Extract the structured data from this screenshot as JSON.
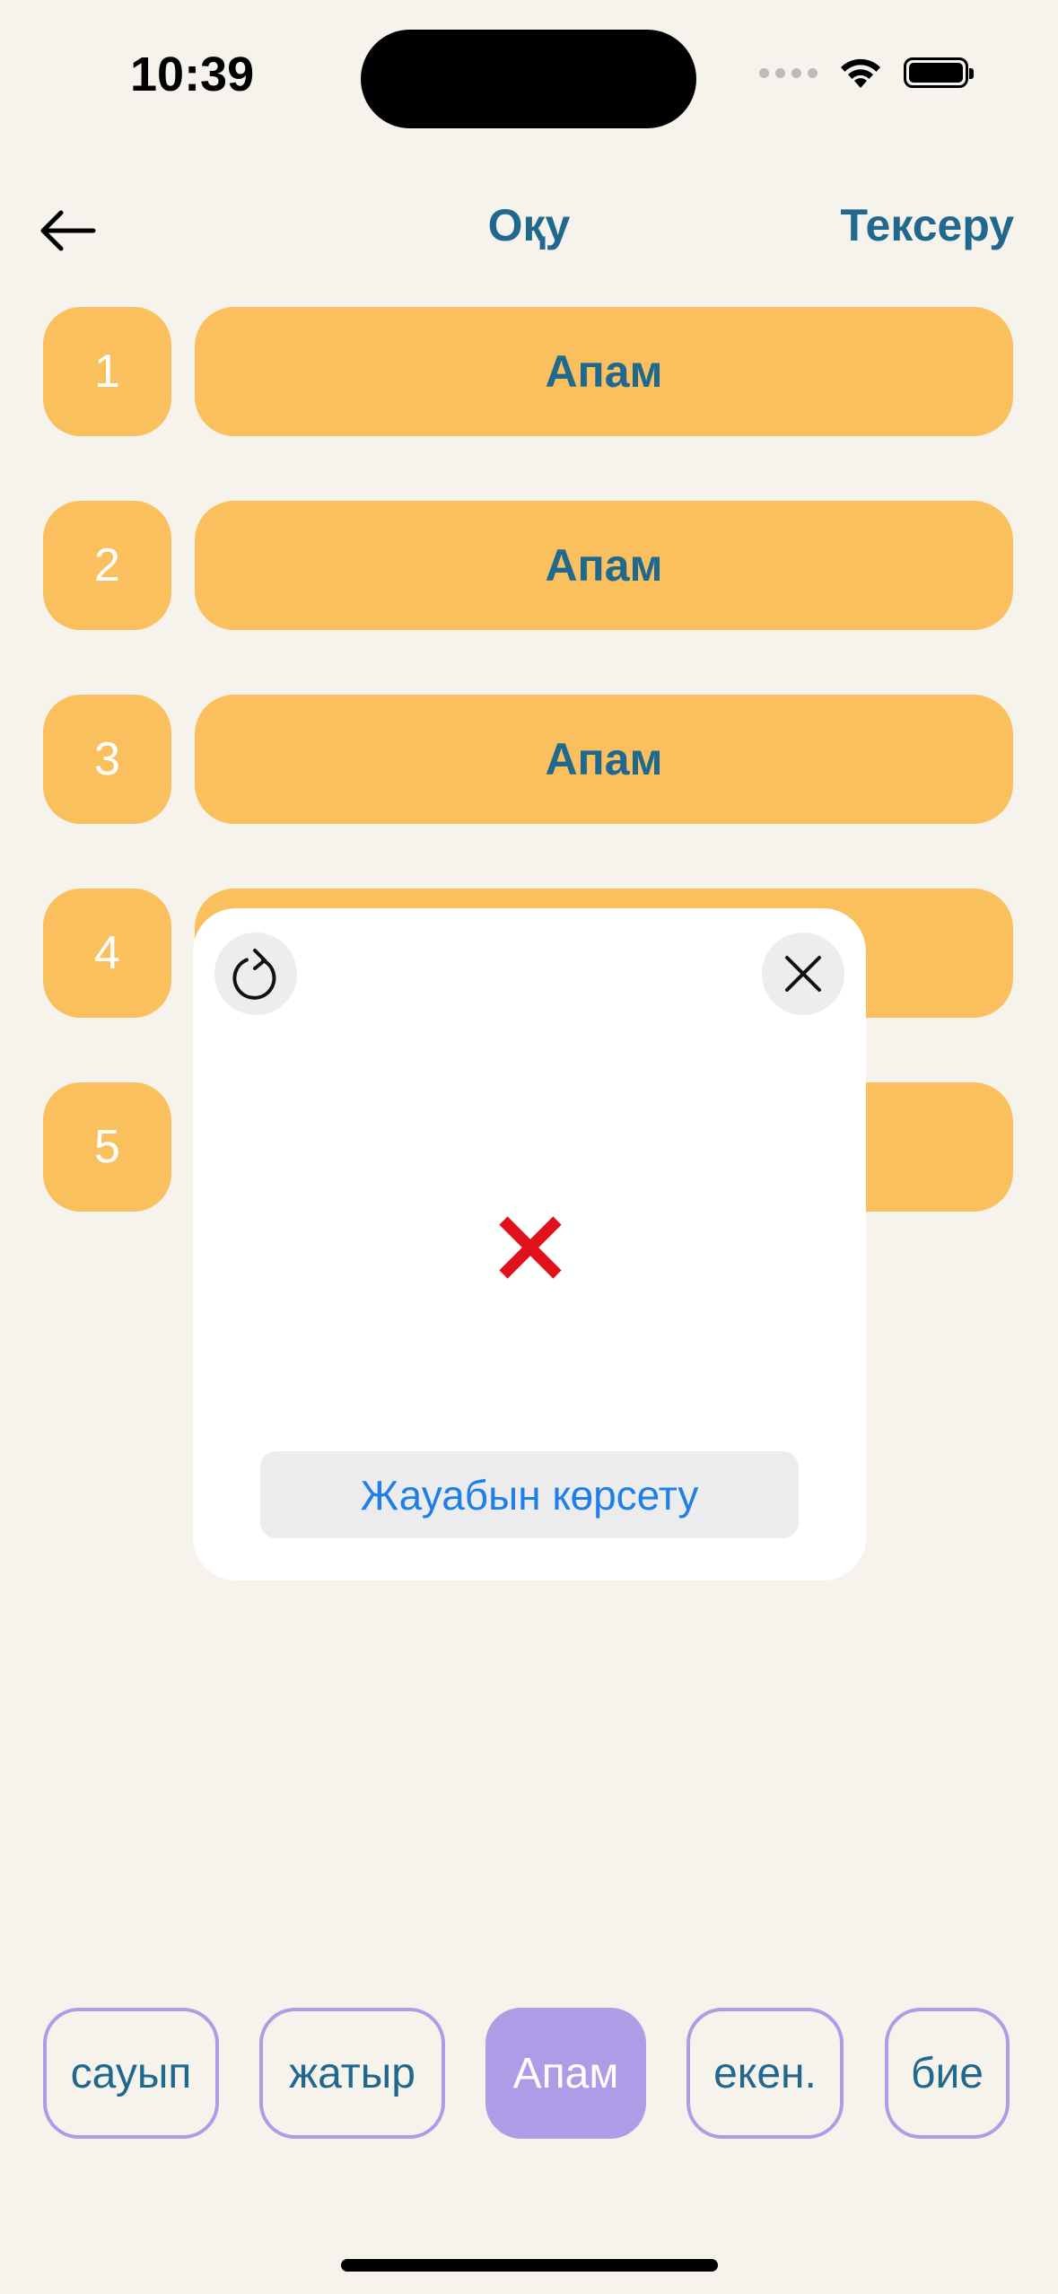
{
  "status_bar": {
    "time": "10:39"
  },
  "nav": {
    "title": "Оқу",
    "check_label": "Тексеру"
  },
  "rows": [
    {
      "number": "1",
      "answer": "Апам"
    },
    {
      "number": "2",
      "answer": "Апам"
    },
    {
      "number": "3",
      "answer": "Апам"
    },
    {
      "number": "4",
      "answer": ""
    },
    {
      "number": "5",
      "answer": ""
    }
  ],
  "popup": {
    "result": "incorrect",
    "show_answer_label": "Жауабын көрсету"
  },
  "word_bank": [
    {
      "label": "сауып",
      "selected": false
    },
    {
      "label": "жатыр",
      "selected": false
    },
    {
      "label": "Апам",
      "selected": true
    },
    {
      "label": "екен.",
      "selected": false
    },
    {
      "label": "бие",
      "selected": false
    }
  ],
  "colors": {
    "background": "#F6F3EC",
    "accent_text": "#21688F",
    "card": "#FBC05E",
    "word_border": "#AE9CE6",
    "error": "#E0111B",
    "link": "#1F7FE8"
  },
  "icons": {
    "back": "arrow-left-icon",
    "refresh": "refresh-icon",
    "close": "close-icon",
    "result": "red-x-icon"
  }
}
